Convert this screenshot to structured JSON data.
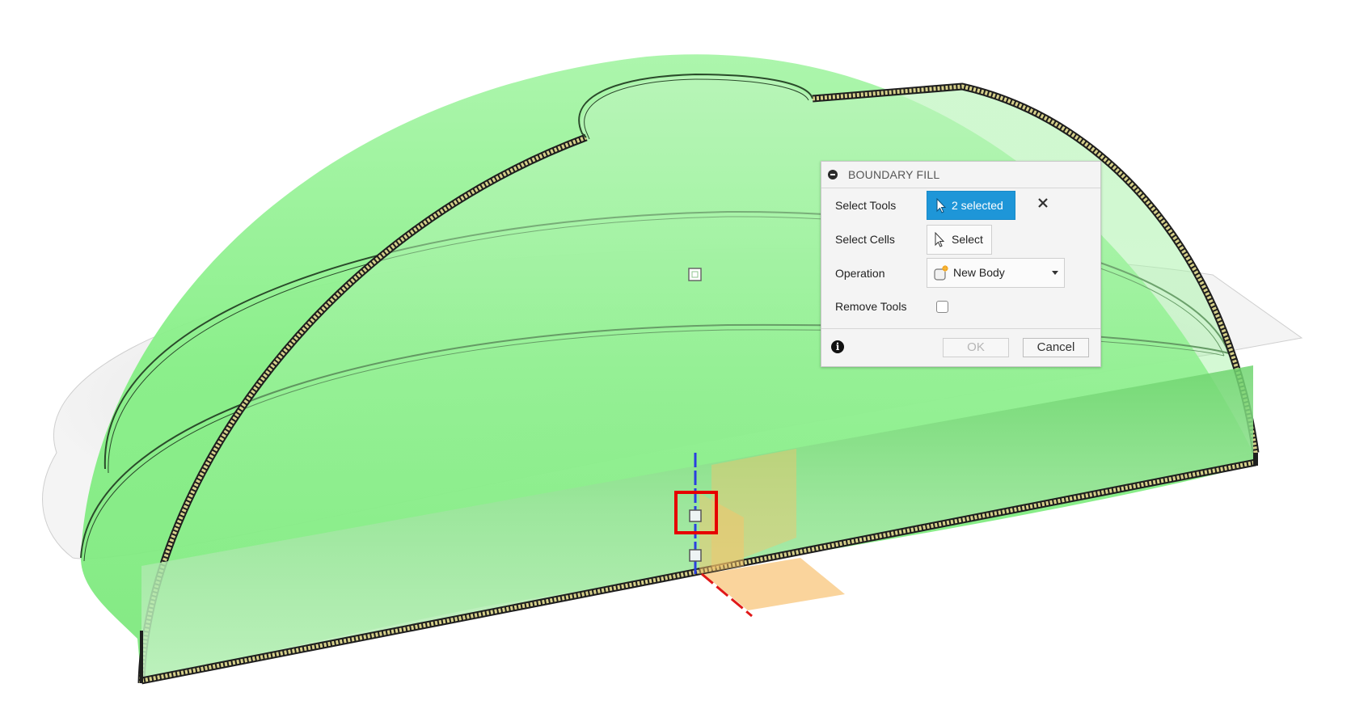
{
  "dialog": {
    "title": "BOUNDARY FILL",
    "select_tools_label": "Select Tools",
    "select_tools_value": "2 selected",
    "select_cells_label": "Select Cells",
    "select_cells_button": "Select",
    "operation_label": "Operation",
    "operation_value": "New Body",
    "remove_tools_label": "Remove Tools",
    "remove_tools_checked": false,
    "ok_label": "OK",
    "cancel_label": "Cancel"
  },
  "colors": {
    "body_fill": "#7ef07e",
    "accent_button": "#1e96d8",
    "highlight_box": "#e60000",
    "origin_plane": "#f5b14a"
  },
  "icons": [
    "collapse-icon",
    "cursor-arrow-icon",
    "clear-x-icon",
    "new-body-icon",
    "dropdown-caret-icon",
    "info-icon"
  ]
}
